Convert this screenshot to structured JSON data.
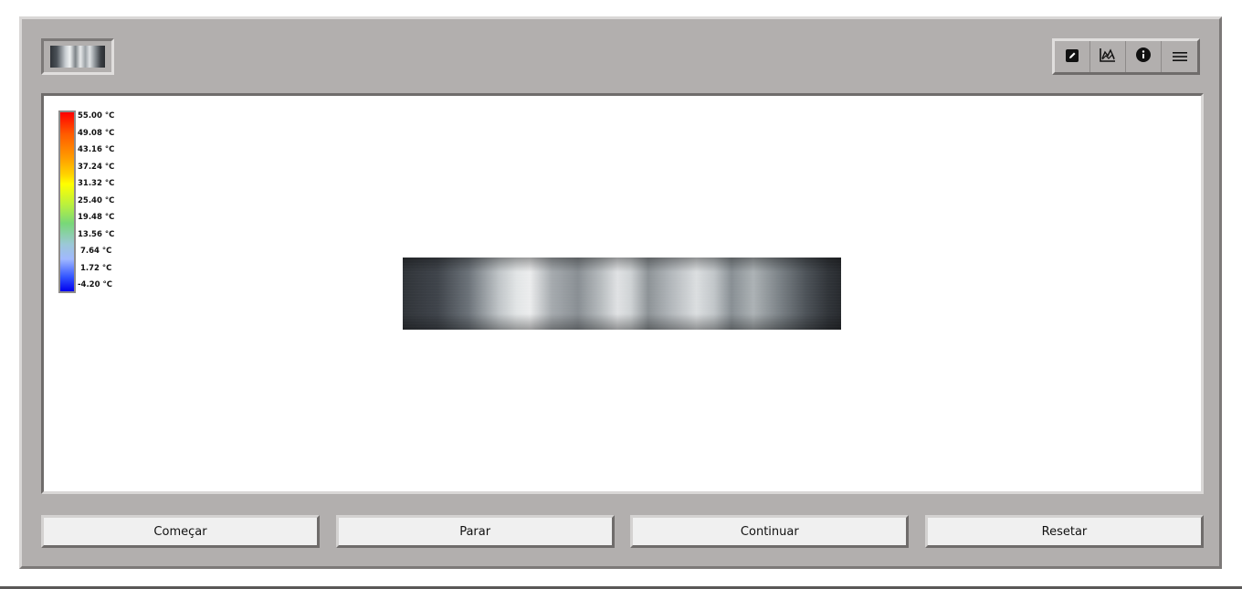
{
  "legend": {
    "labels": [
      "55.00 °C",
      "49.08 °C",
      "43.16 °C",
      "37.24 °C",
      "31.32 °C",
      "25.40 °C",
      "19.48 °C",
      "13.56 °C",
      "7.64 °C",
      "1.72 °C",
      "-4.20 °C"
    ],
    "max": 55.0,
    "min": -4.2,
    "colors": [
      "#ff0000",
      "#ff9a00",
      "#ffff00",
      "#78d878",
      "#9cc8d8",
      "#0000ee"
    ]
  },
  "toolbar": {
    "icons": [
      "edit-icon",
      "chart-icon",
      "info-icon",
      "menu-icon"
    ]
  },
  "controls": {
    "start_label": "Começar",
    "stop_label": "Parar",
    "continue_label": "Continuar",
    "reset_label": "Resetar"
  },
  "colors": {
    "frame": "#b2afae",
    "canvas": "#ffffff",
    "button": "#f0f0f0"
  }
}
